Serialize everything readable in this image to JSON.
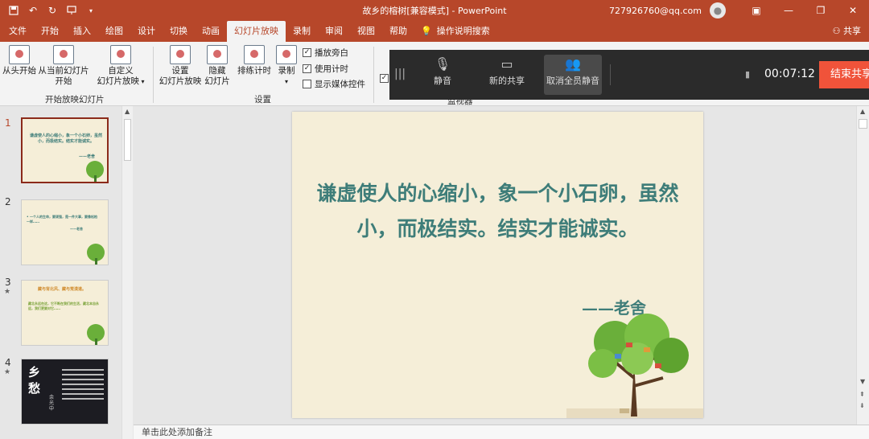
{
  "window": {
    "title": "故乡的榕树[兼容模式] - PowerPoint",
    "account": "727926760@qq.com",
    "qat_icons": [
      "save-icon",
      "undo-icon",
      "redo-icon",
      "present-icon",
      "customize-icon"
    ]
  },
  "tabs": [
    "文件",
    "开始",
    "插入",
    "绘图",
    "设计",
    "切换",
    "动画",
    "幻灯片放映",
    "录制",
    "审阅",
    "视图",
    "帮助"
  ],
  "active_tab": "幻灯片放映",
  "tell_me": "操作说明搜索",
  "share": "共享",
  "ribbon": {
    "from_beginning": "从头开始",
    "from_current_1": "从当前幻灯片",
    "from_current_2": "开始",
    "custom_1": "自定义",
    "custom_2": "幻灯片放映",
    "group_start": "开始放映幻灯片",
    "setup_1": "设置",
    "setup_2": "幻灯片放映",
    "hide_1": "隐藏",
    "hide_2": "幻灯片",
    "rehearse": "排练计时",
    "record": "录制",
    "group_setup": "设置",
    "chk_narration": "播放旁白",
    "chk_timings": "使用计时",
    "chk_media": "显示媒体控件",
    "group_monitors": "监视器"
  },
  "meeting": {
    "mute": "静音",
    "new_share": "新的共享",
    "unmute_all": "取消全员静音",
    "timer": "00:07:12",
    "end_share": "结束共享"
  },
  "thumbnails": [
    {
      "num": "1",
      "text": "谦虚使人的心缩小，象一个小石卵，虽然小，而极结实。结实才能诚实。",
      "author": "——老舍"
    },
    {
      "num": "2",
      "text": "• 一个人的生命，要顽强，是一件大事，要像松柏一样……",
      "author": "——老舍"
    },
    {
      "num": "3",
      "star": "★",
      "text": "藏与背北风、藏与荒漠道。",
      "body": "藏北永远在这，它不断在我们的生活，藏北本自永远，我们更要对它……"
    },
    {
      "num": "4",
      "star": "★",
      "title": "乡愁",
      "author": "余光中"
    }
  ],
  "slide": {
    "quote": "谦虚使人的心缩小，象一个小石卵，虽然小，而极结实。结实才能诚实。",
    "author": "——老舍"
  },
  "notes_placeholder": "单击此处添加备注"
}
